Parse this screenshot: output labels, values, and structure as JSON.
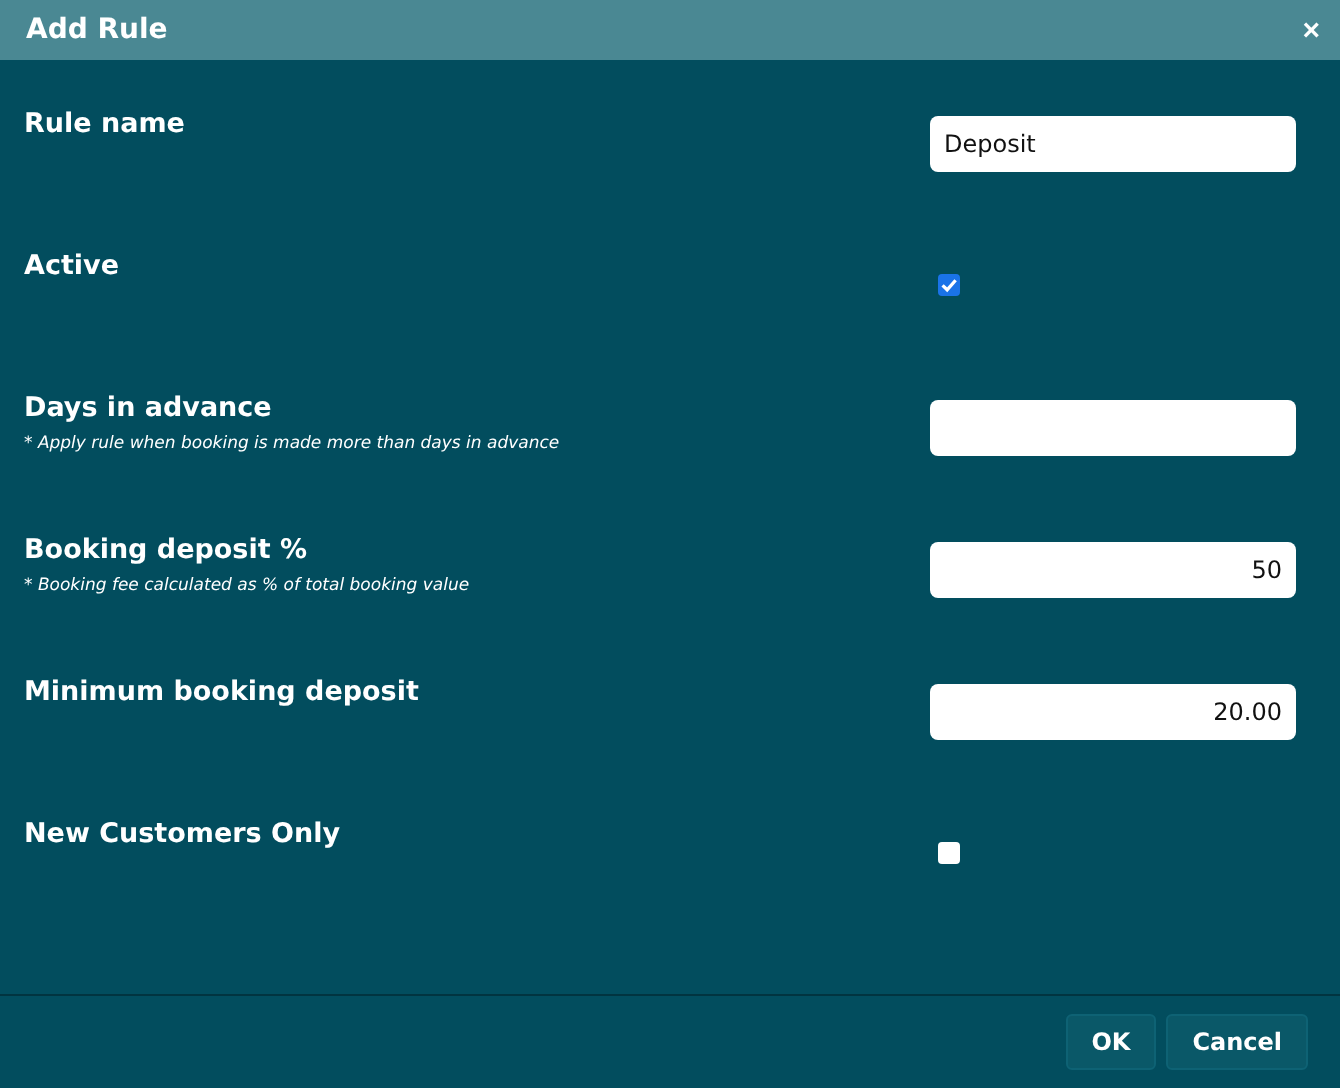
{
  "window": {
    "title": "Add Rule",
    "close": "×"
  },
  "fields": [
    {
      "kind": "text",
      "label": "Rule name",
      "value": "Deposit"
    },
    {
      "kind": "checkbox",
      "label": "Active",
      "checked": true
    },
    {
      "kind": "text",
      "label": "Days in advance",
      "hint": "* Apply rule when booking is made more than days in advance"
    },
    {
      "kind": "number",
      "label": "Booking deposit %",
      "hint": "* Booking fee calculated as % of total booking value",
      "value": "50"
    },
    {
      "kind": "number",
      "label": "Minimum booking deposit",
      "value": "20.00"
    },
    {
      "kind": "checkbox",
      "label": "New Customers Only",
      "checked": false
    }
  ],
  "buttons": [
    "OK",
    "Cancel"
  ]
}
